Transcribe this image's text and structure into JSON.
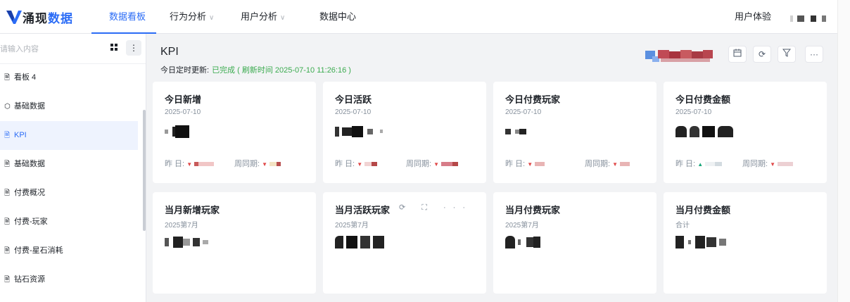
{
  "logo": {
    "text_a": "涌现",
    "text_b": "数据"
  },
  "nav": {
    "items": [
      {
        "label": "数据看板",
        "caret": ""
      },
      {
        "label": "行为分析",
        "caret": "∨"
      },
      {
        "label": "用户分析",
        "caret": "∨"
      },
      {
        "label": "数据中心",
        "caret": ""
      }
    ],
    "user_experience": "用户体验"
  },
  "sidebar": {
    "search_placeholder": "请输入内容",
    "items": [
      {
        "label": "看板 4",
        "icon": "board-icon"
      },
      {
        "label": "基础数据",
        "icon": "cube-icon"
      },
      {
        "label": "KPI",
        "icon": "board-icon"
      },
      {
        "label": "基础数据",
        "icon": "board-icon"
      },
      {
        "label": "付费概况",
        "icon": "board-icon"
      },
      {
        "label": "付费-玩家",
        "icon": "board-icon"
      },
      {
        "label": "付费-星石消耗",
        "icon": "board-icon"
      },
      {
        "label": "钻石资源",
        "icon": "board-icon"
      }
    ]
  },
  "main": {
    "title": "KPI",
    "refresh_label": "今日定时更新:",
    "refresh_status": "已完成 ( 刷新时间 2025-07-10 11:26:16 )"
  },
  "cards_row1": [
    {
      "title": "今日新增",
      "date": "2025-07-10",
      "yesterday_label": "昨 日:",
      "week_label": "周同期:"
    },
    {
      "title": "今日活跃",
      "date": "2025-07-10",
      "yesterday_label": "昨 日:",
      "week_label": "周同期:"
    },
    {
      "title": "今日付费玩家",
      "date": "2025-07-10",
      "yesterday_label": "昨 日:",
      "week_label": "周同期:"
    },
    {
      "title": "今日付费金额",
      "date": "2025-07-10",
      "yesterday_label": "昨 日:",
      "week_label": "周同期:"
    }
  ],
  "cards_row2": [
    {
      "title": "当月新增玩家",
      "date": "2025第7月"
    },
    {
      "title": "当月活跃玩家",
      "date": "2025第7月",
      "tools": "⟳ ⛶ ···"
    },
    {
      "title": "当月付费玩家",
      "date": "2025第7月"
    },
    {
      "title": "当月付费金额",
      "date": "合计"
    }
  ],
  "colors": {
    "accent": "#2b6cf6",
    "success": "#3bab4f",
    "down": "#e04848",
    "up": "#1aa77a"
  }
}
